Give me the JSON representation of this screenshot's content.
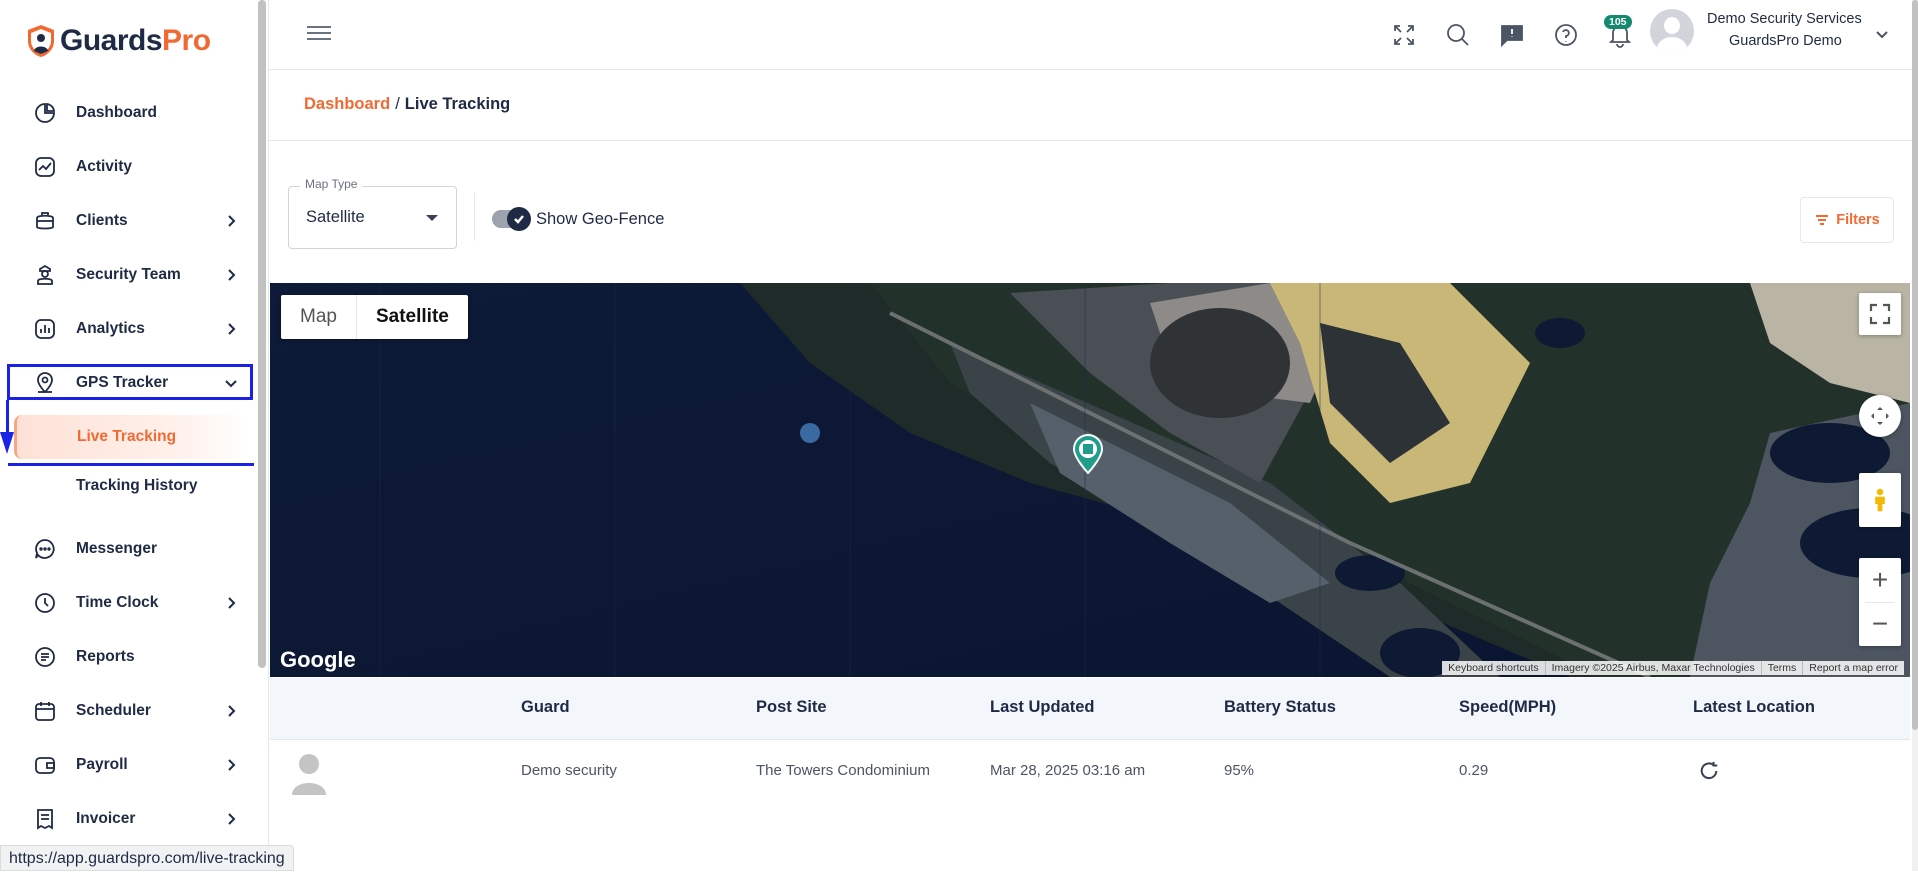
{
  "brand": {
    "part1": "Guards",
    "part2": "Pro",
    "accent": "#f26a33",
    "navy": "#1f2a44"
  },
  "sidebar": {
    "items": [
      {
        "label": "Dashboard",
        "icon": "dashboard-icon"
      },
      {
        "label": "Activity",
        "icon": "activity-chart-icon"
      },
      {
        "label": "Clients",
        "icon": "briefcase-icon"
      },
      {
        "label": "Security Team",
        "icon": "guard-icon"
      },
      {
        "label": "Analytics",
        "icon": "analytics-icon"
      },
      {
        "label": "GPS Tracker",
        "icon": "location-pin-icon"
      },
      {
        "label": "Live Tracking"
      },
      {
        "label": "Tracking History"
      },
      {
        "label": "Messenger",
        "icon": "chat-icon"
      },
      {
        "label": "Time Clock",
        "icon": "clock-icon"
      },
      {
        "label": "Reports",
        "icon": "report-icon"
      },
      {
        "label": "Scheduler",
        "icon": "calendar-icon"
      },
      {
        "label": "Payroll",
        "icon": "wallet-icon"
      },
      {
        "label": "Invoicer",
        "icon": "invoice-icon"
      }
    ]
  },
  "header": {
    "notification_count": "105",
    "user_name": "Demo Security Services",
    "user_org": "GuardsPro Demo"
  },
  "breadcrumb": {
    "link": "Dashboard",
    "separator": "/",
    "current": "Live Tracking"
  },
  "controls": {
    "map_type_label": "Map Type",
    "map_type_value": "Satellite",
    "geofence_label": "Show Geo-Fence",
    "geofence_on": true,
    "filters_label": "Filters"
  },
  "map": {
    "type_map": "Map",
    "type_satellite": "Satellite",
    "google": "Google",
    "attribution": [
      "Keyboard shortcuts",
      "Imagery ©2025 Airbus, Maxar Technologies",
      "Terms",
      "Report a map error"
    ]
  },
  "table": {
    "headers": [
      "Guard",
      "Post Site",
      "Last Updated",
      "Battery Status",
      "Speed(MPH)",
      "Latest Location"
    ],
    "rows": [
      {
        "guard": "Demo security",
        "post_site": "The Towers Condominium",
        "last_updated": "Mar 28, 2025 03:16 am",
        "battery": "95%",
        "speed": "0.29"
      }
    ]
  },
  "status_url": "https://app.guardspro.com/live-tracking"
}
